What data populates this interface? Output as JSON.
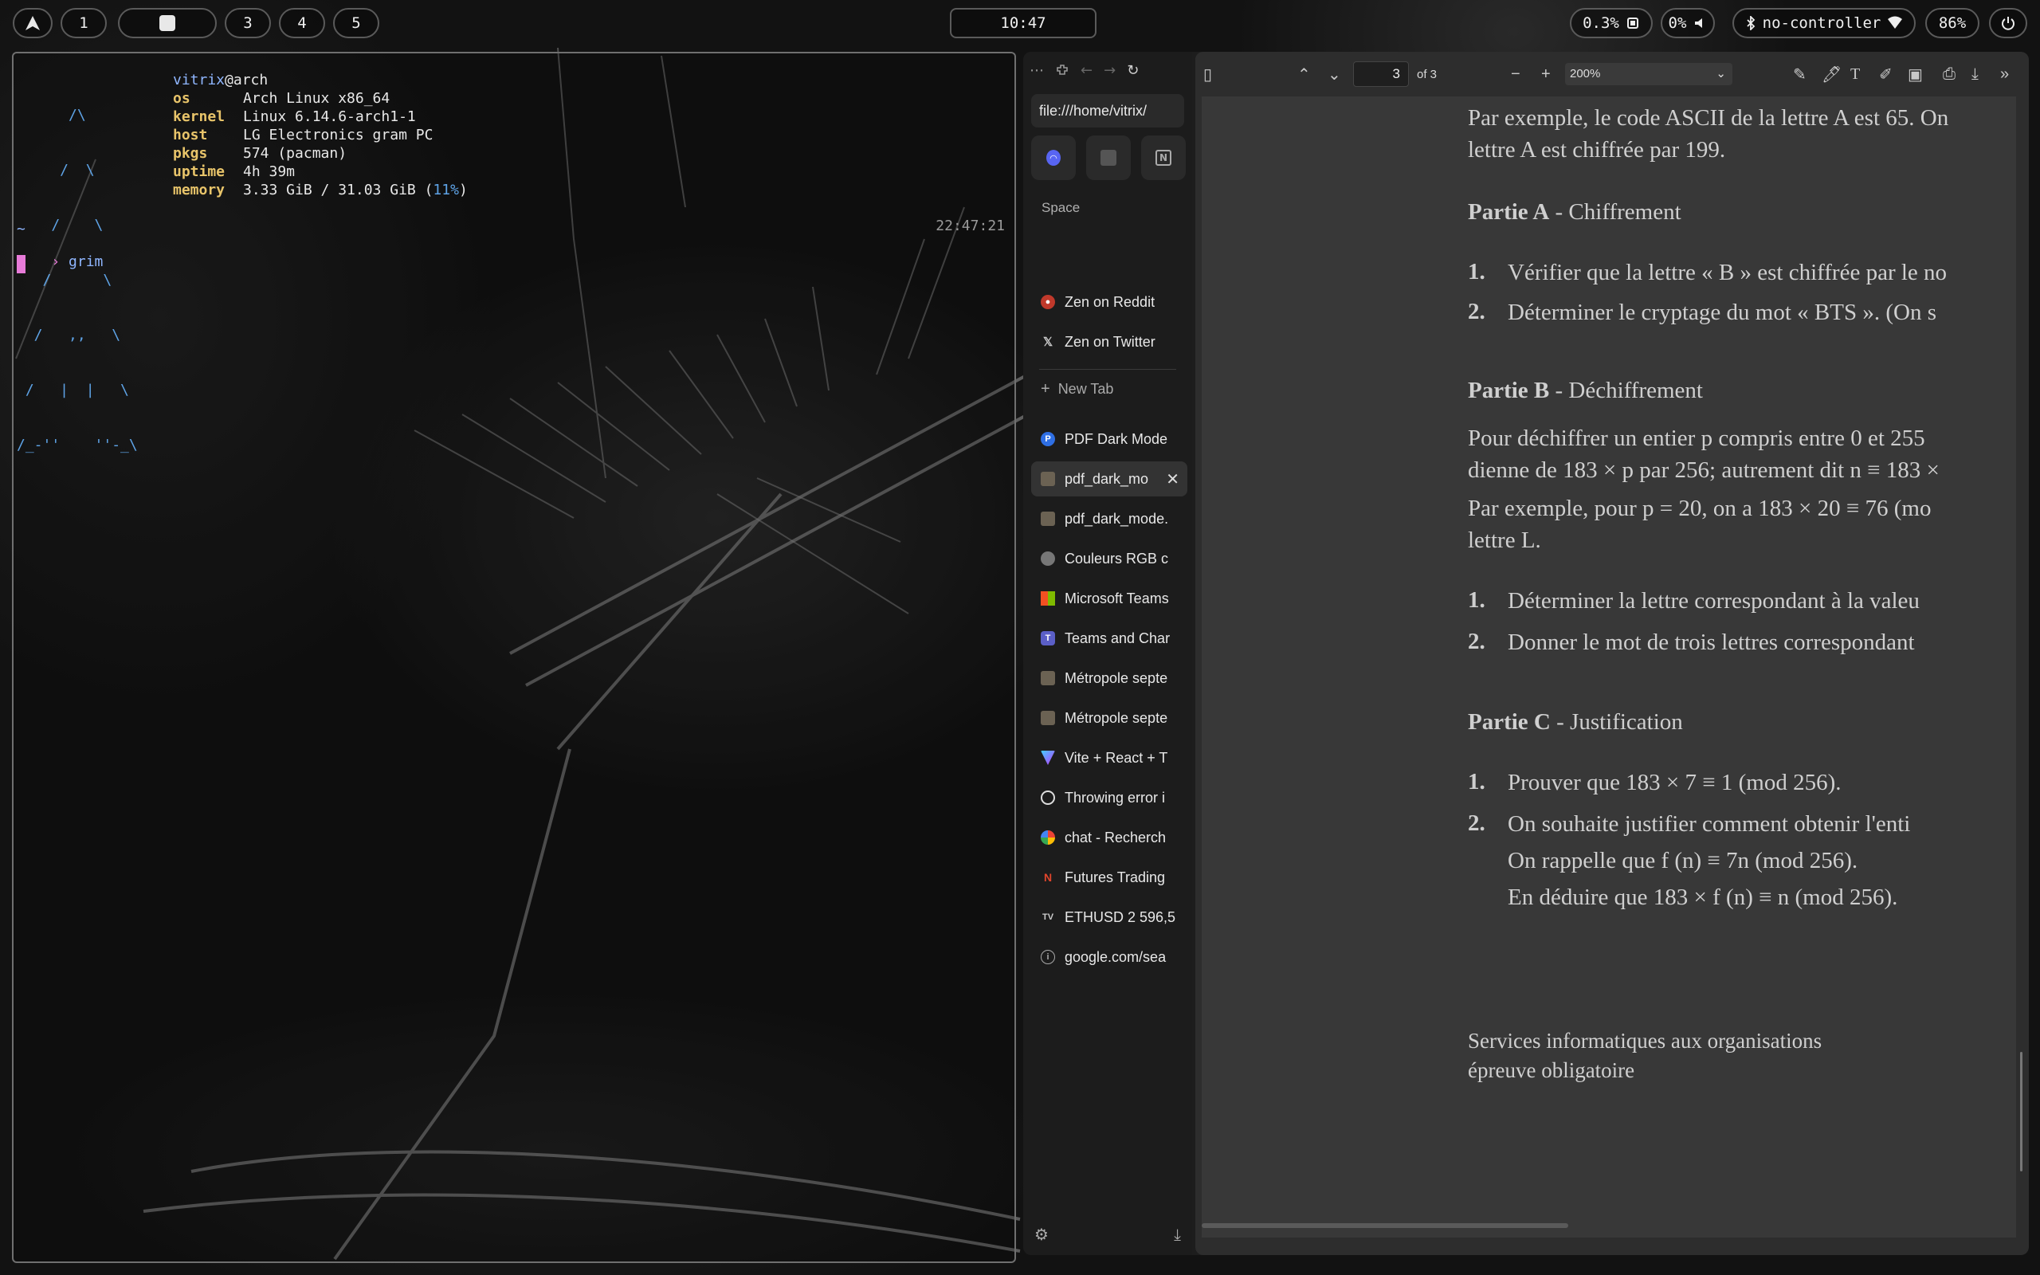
{
  "topbar": {
    "workspaces": [
      "1",
      "3",
      "4",
      "5"
    ],
    "clock": "10:47",
    "cpu": "0.3%",
    "volume": "0%",
    "bluetooth": "no-controller",
    "battery": "86%"
  },
  "terminal": {
    "logo": [
      "      /\\",
      "     /  \\",
      "    /    \\",
      "   /      \\",
      "  /   ,,   \\",
      " /   |  |   \\",
      "/_-''    ''-_\\"
    ],
    "user": "vitrix",
    "host": "@arch",
    "fields": [
      {
        "key": "os",
        "value": "Arch Linux x86_64"
      },
      {
        "key": "kernel",
        "value": "Linux 6.14.6-arch1-1"
      },
      {
        "key": "host",
        "value": "LG Electronics gram PC"
      },
      {
        "key": "pkgs",
        "value": "574 (pacman)"
      },
      {
        "key": "uptime",
        "value": "4h 39m"
      }
    ],
    "memory_key": "memory",
    "memory_value": "3.33 GiB / 31.03 GiB (",
    "memory_percent": "11%",
    "memory_close": ")",
    "timestamp": "22:47:21",
    "cwd": "~",
    "prompt": "›",
    "command": "grim"
  },
  "browser": {
    "url": "file:///home/vitrix/",
    "space_label": "Space",
    "pinned_tabs": [
      "Zen on Reddit",
      "Zen on Twitter"
    ],
    "new_tab": "New Tab",
    "tabs": [
      {
        "label": "PDF Dark Mode",
        "icon": "pdf-dark-mode-icon"
      },
      {
        "label": "pdf_dark_mo",
        "icon": "page-icon",
        "active": true
      },
      {
        "label": "pdf_dark_mode.",
        "icon": "page-icon"
      },
      {
        "label": "Couleurs RGB c",
        "icon": "globe-icon"
      },
      {
        "label": "Microsoft Teams",
        "icon": "microsoft-icon"
      },
      {
        "label": "Teams and Char",
        "icon": "teams-icon"
      },
      {
        "label": "Métropole septe",
        "icon": "page-icon"
      },
      {
        "label": "Métropole septe",
        "icon": "page-icon"
      },
      {
        "label": "Vite + React + T",
        "icon": "vite-icon"
      },
      {
        "label": "Throwing error i",
        "icon": "github-icon"
      },
      {
        "label": "chat - Recherch",
        "icon": "google-icon"
      },
      {
        "label": "Futures Trading",
        "icon": "ninjatrader-icon"
      },
      {
        "label": "ETHUSD 2 596,5",
        "icon": "tradingview-icon"
      },
      {
        "label": "google.com/sea",
        "icon": "info-icon"
      }
    ]
  },
  "pdf": {
    "page": "3",
    "of_pages": "of 3",
    "zoom": "200%",
    "lines": {
      "intro1": "Par exemple, le code ASCII de la lettre A est 65. On",
      "intro2": "lettre A est chiffrée par 199.",
      "partA_bold": "Partie A",
      "partA_rest": " - Chiffrement",
      "a1": "Vérifier que la lettre « B » est chiffrée par le no",
      "a2": "Déterminer le cryptage du mot « BTS ». (On s",
      "partB_bold": "Partie B",
      "partB_rest": " - Déchiffrement",
      "b_p1": "Pour déchiffrer un entier p compris entre 0 et 255",
      "b_p2": "dienne de 183 × p par 256; autrement dit n ≡ 183 ×",
      "b_p3": "Par exemple, pour p = 20, on a 183 × 20 ≡ 76 (mo",
      "b_p4": "lettre L.",
      "b1": "Déterminer la lettre correspondant à la valeu",
      "b2": "Donner le mot de trois lettres correspondant",
      "partC_bold": "Partie C",
      "partC_rest": " - Justification",
      "c1": "Prouver que 183 × 7 ≡ 1 (mod 256).",
      "c2": "On souhaite justifier comment obtenir l'enti",
      "c2b": "On rappelle que f (n) ≡ 7n (mod 256).",
      "c2c": "En déduire que 183 × f (n) ≡ n (mod 256).",
      "footer1": "Services informatiques aux organisations",
      "footer2": "épreuve obligatoire"
    },
    "num1": "1.",
    "num2": "2."
  }
}
